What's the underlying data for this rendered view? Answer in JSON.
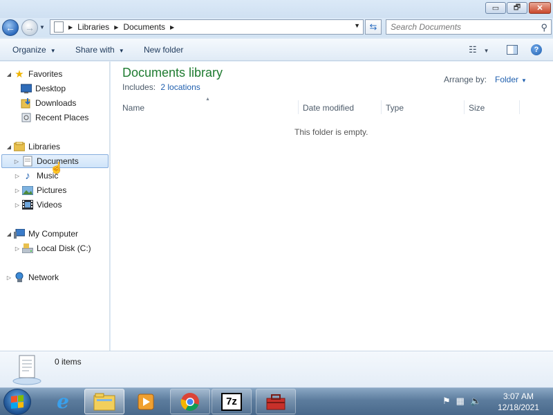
{
  "window": {
    "controls": {
      "minimize": "▭",
      "maximize": "🗗",
      "close": "✕"
    }
  },
  "address_bar": {
    "back": "←",
    "breadcrumbs": [
      "Libraries",
      "Documents"
    ],
    "search_placeholder": "Search Documents"
  },
  "command_bar": {
    "organize": "Organize",
    "share_with": "Share with",
    "new_folder": "New folder"
  },
  "nav_pane": {
    "favorites": {
      "label": "Favorites",
      "items": [
        "Desktop",
        "Downloads",
        "Recent Places"
      ]
    },
    "libraries": {
      "label": "Libraries",
      "items": [
        "Documents",
        "Music",
        "Pictures",
        "Videos"
      ],
      "selected": "Documents"
    },
    "computer": {
      "label": "My Computer",
      "items": [
        "Local Disk (C:)"
      ]
    },
    "network": {
      "label": "Network"
    }
  },
  "content": {
    "title": "Documents library",
    "includes_label": "Includes:",
    "includes_link": "2 locations",
    "arrange_label": "Arrange by:",
    "arrange_value": "Folder",
    "columns": [
      "Name",
      "Date modified",
      "Type",
      "Size"
    ],
    "empty_message": "This folder is empty."
  },
  "details": {
    "item_count": "0 items"
  },
  "taskbar": {
    "apps": [
      "internet-explorer",
      "windows-explorer",
      "media-player",
      "chrome",
      "7-zip",
      "toolbox"
    ],
    "active_app": "windows-explorer",
    "clock": {
      "time": "3:07 AM",
      "date": "12/18/2021"
    }
  },
  "colors": {
    "library_title": "#1e7b30",
    "link": "#1f5fae",
    "selection": "#cfe4fa"
  }
}
